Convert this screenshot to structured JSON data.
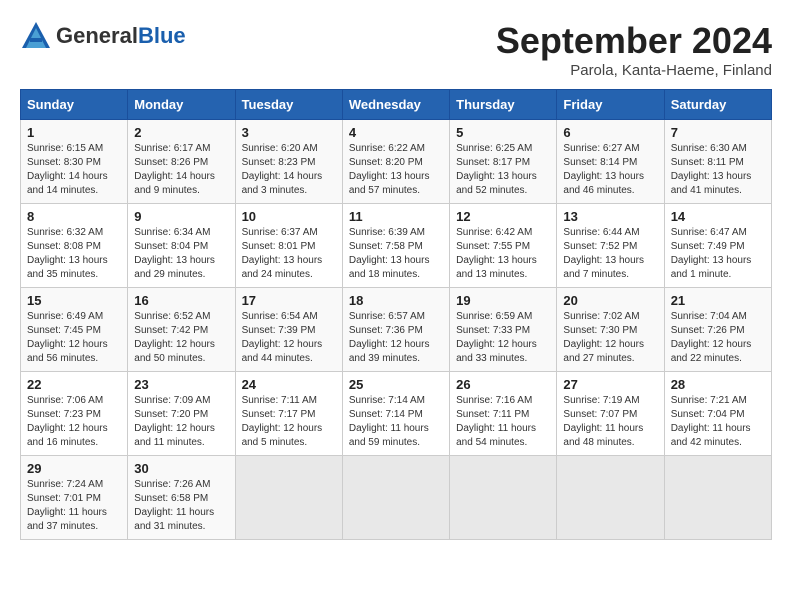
{
  "header": {
    "logo_general": "General",
    "logo_blue": "Blue",
    "month_title": "September 2024",
    "location": "Parola, Kanta-Haeme, Finland"
  },
  "days_of_week": [
    "Sunday",
    "Monday",
    "Tuesday",
    "Wednesday",
    "Thursday",
    "Friday",
    "Saturday"
  ],
  "weeks": [
    [
      {
        "day": "1",
        "info": "Sunrise: 6:15 AM\nSunset: 8:30 PM\nDaylight: 14 hours\nand 14 minutes."
      },
      {
        "day": "2",
        "info": "Sunrise: 6:17 AM\nSunset: 8:26 PM\nDaylight: 14 hours\nand 9 minutes."
      },
      {
        "day": "3",
        "info": "Sunrise: 6:20 AM\nSunset: 8:23 PM\nDaylight: 14 hours\nand 3 minutes."
      },
      {
        "day": "4",
        "info": "Sunrise: 6:22 AM\nSunset: 8:20 PM\nDaylight: 13 hours\nand 57 minutes."
      },
      {
        "day": "5",
        "info": "Sunrise: 6:25 AM\nSunset: 8:17 PM\nDaylight: 13 hours\nand 52 minutes."
      },
      {
        "day": "6",
        "info": "Sunrise: 6:27 AM\nSunset: 8:14 PM\nDaylight: 13 hours\nand 46 minutes."
      },
      {
        "day": "7",
        "info": "Sunrise: 6:30 AM\nSunset: 8:11 PM\nDaylight: 13 hours\nand 41 minutes."
      }
    ],
    [
      {
        "day": "8",
        "info": "Sunrise: 6:32 AM\nSunset: 8:08 PM\nDaylight: 13 hours\nand 35 minutes."
      },
      {
        "day": "9",
        "info": "Sunrise: 6:34 AM\nSunset: 8:04 PM\nDaylight: 13 hours\nand 29 minutes."
      },
      {
        "day": "10",
        "info": "Sunrise: 6:37 AM\nSunset: 8:01 PM\nDaylight: 13 hours\nand 24 minutes."
      },
      {
        "day": "11",
        "info": "Sunrise: 6:39 AM\nSunset: 7:58 PM\nDaylight: 13 hours\nand 18 minutes."
      },
      {
        "day": "12",
        "info": "Sunrise: 6:42 AM\nSunset: 7:55 PM\nDaylight: 13 hours\nand 13 minutes."
      },
      {
        "day": "13",
        "info": "Sunrise: 6:44 AM\nSunset: 7:52 PM\nDaylight: 13 hours\nand 7 minutes."
      },
      {
        "day": "14",
        "info": "Sunrise: 6:47 AM\nSunset: 7:49 PM\nDaylight: 13 hours\nand 1 minute."
      }
    ],
    [
      {
        "day": "15",
        "info": "Sunrise: 6:49 AM\nSunset: 7:45 PM\nDaylight: 12 hours\nand 56 minutes."
      },
      {
        "day": "16",
        "info": "Sunrise: 6:52 AM\nSunset: 7:42 PM\nDaylight: 12 hours\nand 50 minutes."
      },
      {
        "day": "17",
        "info": "Sunrise: 6:54 AM\nSunset: 7:39 PM\nDaylight: 12 hours\nand 44 minutes."
      },
      {
        "day": "18",
        "info": "Sunrise: 6:57 AM\nSunset: 7:36 PM\nDaylight: 12 hours\nand 39 minutes."
      },
      {
        "day": "19",
        "info": "Sunrise: 6:59 AM\nSunset: 7:33 PM\nDaylight: 12 hours\nand 33 minutes."
      },
      {
        "day": "20",
        "info": "Sunrise: 7:02 AM\nSunset: 7:30 PM\nDaylight: 12 hours\nand 27 minutes."
      },
      {
        "day": "21",
        "info": "Sunrise: 7:04 AM\nSunset: 7:26 PM\nDaylight: 12 hours\nand 22 minutes."
      }
    ],
    [
      {
        "day": "22",
        "info": "Sunrise: 7:06 AM\nSunset: 7:23 PM\nDaylight: 12 hours\nand 16 minutes."
      },
      {
        "day": "23",
        "info": "Sunrise: 7:09 AM\nSunset: 7:20 PM\nDaylight: 12 hours\nand 11 minutes."
      },
      {
        "day": "24",
        "info": "Sunrise: 7:11 AM\nSunset: 7:17 PM\nDaylight: 12 hours\nand 5 minutes."
      },
      {
        "day": "25",
        "info": "Sunrise: 7:14 AM\nSunset: 7:14 PM\nDaylight: 11 hours\nand 59 minutes."
      },
      {
        "day": "26",
        "info": "Sunrise: 7:16 AM\nSunset: 7:11 PM\nDaylight: 11 hours\nand 54 minutes."
      },
      {
        "day": "27",
        "info": "Sunrise: 7:19 AM\nSunset: 7:07 PM\nDaylight: 11 hours\nand 48 minutes."
      },
      {
        "day": "28",
        "info": "Sunrise: 7:21 AM\nSunset: 7:04 PM\nDaylight: 11 hours\nand 42 minutes."
      }
    ],
    [
      {
        "day": "29",
        "info": "Sunrise: 7:24 AM\nSunset: 7:01 PM\nDaylight: 11 hours\nand 37 minutes."
      },
      {
        "day": "30",
        "info": "Sunrise: 7:26 AM\nSunset: 6:58 PM\nDaylight: 11 hours\nand 31 minutes."
      },
      {
        "day": "",
        "info": ""
      },
      {
        "day": "",
        "info": ""
      },
      {
        "day": "",
        "info": ""
      },
      {
        "day": "",
        "info": ""
      },
      {
        "day": "",
        "info": ""
      }
    ]
  ]
}
